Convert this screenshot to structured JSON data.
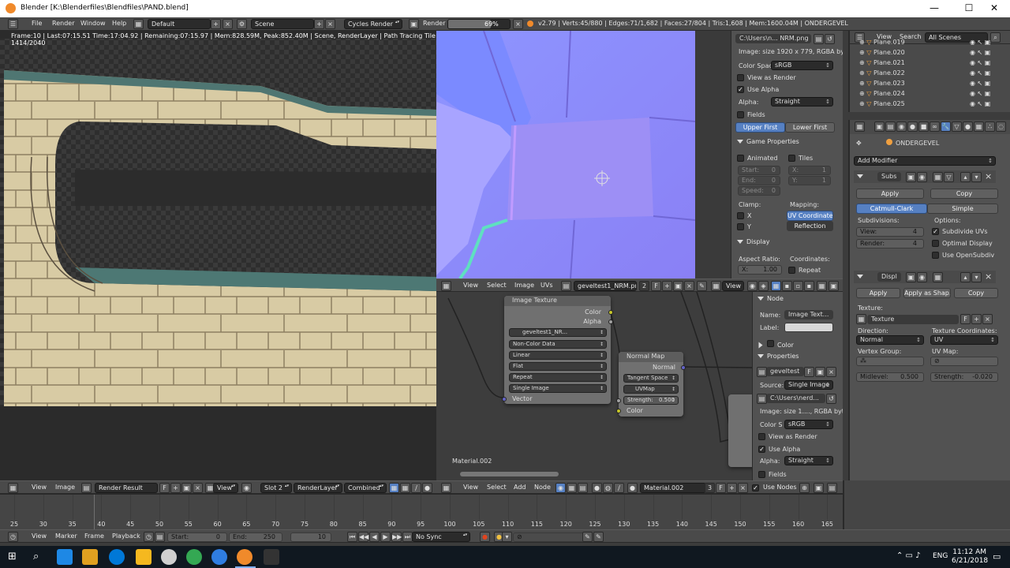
{
  "window": {
    "title": "Blender [K:\\Blenderfiles\\Blendfiles\\PAND.blend]",
    "minimize": "—",
    "maximize": "☐",
    "close": "✕"
  },
  "topbar": {
    "menus": [
      "File",
      "Render",
      "Window",
      "Help"
    ],
    "layout": "Default",
    "scene": "Scene",
    "engine": "Cycles Render",
    "render_label": "Render",
    "progress_pct": 69,
    "progress_text": "69%",
    "stats": "v2.79 | Verts:45/880 | Edges:71/1,682 | Faces:27/804 | Tris:1,608 | Mem:1600.04M | ONDERGEVEL"
  },
  "render_info": "Frame:10 | Last:07:15.51 Time:17:04.92 | Remaining:07:15.97 | Mem:828.59M, Peak:852.40M | Scene, RenderLayer | Path Tracing Tile 1414/2040",
  "image_panel": {
    "image_path": "C:\\Users\\n... NRM.png",
    "image_size": "Image: size 1920 x 779, RGBA byte",
    "color_space_label": "Color Spac",
    "color_space": "sRGB",
    "view_as_render": "View as Render",
    "use_alpha": "Use Alpha",
    "alpha_label": "Alpha:",
    "alpha_value": "Straight",
    "fields": "Fields",
    "upper_first": "Upper First",
    "lower_first": "Lower First",
    "game_props": "Game Properties",
    "animated": "Animated",
    "tiles": "Tiles",
    "start": "Start:",
    "start_val": "0",
    "end": "End:",
    "end_val": "0",
    "speed": "Speed:",
    "speed_val": "0",
    "x_lbl": "X:",
    "x_val": "1",
    "y_lbl": "Y:",
    "y_val": "1",
    "clamp": "Clamp:",
    "clamp_x": "X",
    "clamp_y": "Y",
    "mapping": "Mapping:",
    "uv_coords": "UV Coordinates",
    "reflection": "Reflection",
    "display": "Display",
    "aspect_ratio": "Aspect Ratio:",
    "coordinates": "Coordinates:",
    "aspect_x": "X:",
    "aspect_x_val": "1.00",
    "repeat": "Repeat"
  },
  "uv_header": {
    "menus": [
      "View",
      "Select",
      "Image",
      "UVs"
    ],
    "image_name": "geveltest1_NRM.pn...",
    "users": "2",
    "fake": "F",
    "view": "View"
  },
  "node_editor": {
    "image_texture": {
      "title": "Image Texture",
      "out_color": "Color",
      "out_alpha": "Alpha",
      "image": "geveltest1_NR...",
      "users": "2",
      "fake": "F",
      "color_data": "Non-Color Data",
      "interp": "Linear",
      "projection": "Flat",
      "extension": "Repeat",
      "source": "Single Image",
      "vector": "Vector"
    },
    "normal_map": {
      "title": "Normal Map",
      "out_normal": "Normal",
      "space": "Tangent Space",
      "uvmap": "UVMap",
      "strength_label": "Strength:",
      "strength": "0.500",
      "in_color": "Color"
    },
    "material_label": "Material.002"
  },
  "node_panel": {
    "node": "Node",
    "name_label": "Name:",
    "name": "Image Text...",
    "label_label": "Label:",
    "color": "Color",
    "properties": "Properties",
    "image": "geveltest",
    "fake": "F",
    "source_label": "Source:",
    "source": "Single Image",
    "path": "C:\\Users\\nerd...",
    "size": "Image: size 1...., RGBA byte",
    "cs_label": "Color S",
    "cs_value": "sRGB",
    "view_as_render": "View as Render",
    "use_alpha": "Use Alpha",
    "alpha_label": "Alpha:",
    "alpha": "Straight",
    "fields": "Fields"
  },
  "outliner": {
    "menus": [
      "View",
      "Search"
    ],
    "scenes": "All Scenes",
    "items": [
      "Plane.019",
      "Plane.020",
      "Plane.021",
      "Plane.022",
      "Plane.023",
      "Plane.024",
      "Plane.025"
    ]
  },
  "properties": {
    "object": "ONDERGEVEL",
    "add_modifier": "Add Modifier",
    "subsurf": {
      "name": "Subs",
      "apply": "Apply",
      "copy": "Copy",
      "catmull": "Catmull-Clark",
      "simple": "Simple",
      "subdivisions": "Subdivisions:",
      "options": "Options:",
      "view_label": "View:",
      "view_val": "4",
      "render_label": "Render:",
      "render_val": "4",
      "subdivide_uvs": "Subdivide UVs",
      "optimal": "Optimal Display",
      "opensubdiv": "Use OpenSubdiv"
    },
    "displace": {
      "name": "Displ",
      "apply": "Apply",
      "apply_shape": "Apply as Shap...",
      "copy": "Copy",
      "texture_label": "Texture:",
      "texture": "Texture",
      "fake": "F",
      "direction_label": "Direction:",
      "direction": "Normal",
      "texcoords_label": "Texture Coordinates:",
      "texcoords": "UV",
      "vgroup_label": "Vertex Group:",
      "uvmap_label": "UV Map:",
      "midlevel_label": "Midlevel:",
      "midlevel": "0.500",
      "strength_label": "Strength:",
      "strength": "-0.020"
    }
  },
  "image_editor_header": {
    "menus": [
      "View",
      "Image"
    ],
    "image": "Render Result",
    "fake": "F",
    "view": "View",
    "slot": "Slot 2",
    "layer": "RenderLayer",
    "pass": "Combined"
  },
  "node_header": {
    "menus": [
      "View",
      "Select",
      "Add",
      "Node"
    ],
    "material": "Material.002",
    "users": "3",
    "fake": "F",
    "use_nodes": "Use Nodes"
  },
  "timeline": {
    "ticks": [
      "25",
      "30",
      "35",
      "40",
      "45",
      "50",
      "55",
      "60",
      "65",
      "70",
      "75",
      "80",
      "85",
      "90",
      "95",
      "100",
      "105",
      "110",
      "115",
      "120",
      "125",
      "130",
      "135",
      "140",
      "145",
      "150",
      "155",
      "160",
      "165"
    ],
    "menus": [
      "View",
      "Marker",
      "Frame",
      "Playback"
    ],
    "start_label": "Start:",
    "start": "0",
    "end_label": "End:",
    "end": "250",
    "current": "10",
    "sync": "No Sync"
  },
  "taskbar": {
    "lang": "ENG",
    "time": "11:12 AM",
    "date": "6/21/2018"
  }
}
